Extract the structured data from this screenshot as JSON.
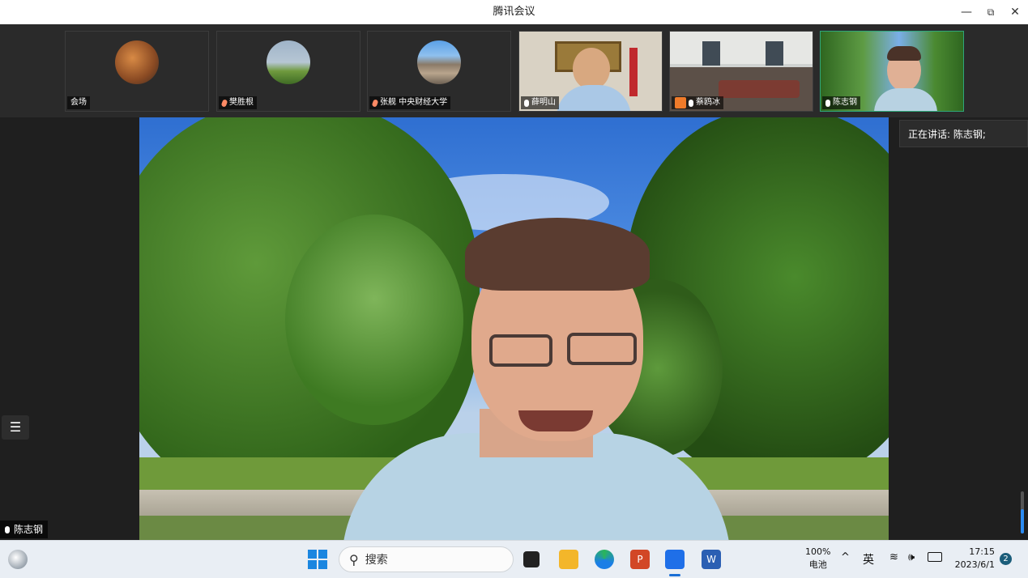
{
  "window": {
    "title": "腾讯会议",
    "minimize": "—",
    "restore": "⧉",
    "close": "✕"
  },
  "participants": [
    {
      "name": "会场",
      "mic": "none",
      "avatar": "photo"
    },
    {
      "name": "樊胜根",
      "mic": "muted",
      "avatar": "rainbow-photo"
    },
    {
      "name": "张舰  中央财经大学",
      "mic": "muted",
      "avatar": "mountain-photo"
    },
    {
      "name": "薛明山",
      "mic": "on",
      "avatar": "video"
    },
    {
      "name": "蔡鸥冰",
      "mic": "on",
      "avatar": "video"
    },
    {
      "name": "陈志钢",
      "mic": "on",
      "avatar": "video",
      "active": true
    }
  ],
  "speaking": {
    "label": "正在讲话:",
    "name": "陈志钢;"
  },
  "main_speaker": {
    "name": "陈志钢"
  },
  "taskbar": {
    "search_placeholder": "搜索",
    "battery_percent": "100%",
    "battery_label": "电池",
    "ime": "英",
    "caret": "^",
    "time": "17:15",
    "date": "2023/6/1",
    "notifications": "2"
  },
  "colors": {
    "active_border": "#2ea67a",
    "accent_blue": "#2b8bf2"
  }
}
